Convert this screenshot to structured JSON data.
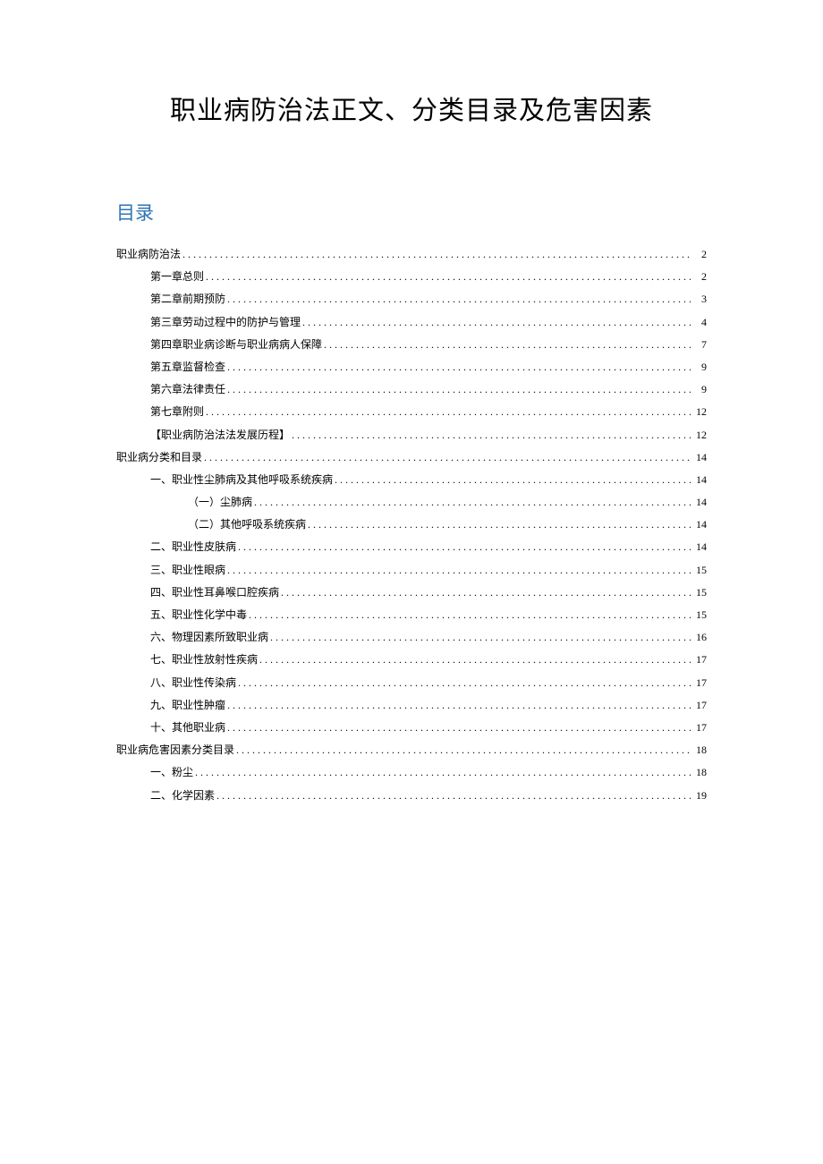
{
  "title": "职业病防治法正文、分类目录及危害因素",
  "toc_heading": "目录",
  "toc": [
    {
      "level": 0,
      "text": "职业病防治法",
      "page": "2"
    },
    {
      "level": 1,
      "text": "第一章总则",
      "page": "2"
    },
    {
      "level": 1,
      "text": "第二章前期预防",
      "page": "3"
    },
    {
      "level": 1,
      "text": "第三章劳动过程中的防护与管理",
      "page": "4"
    },
    {
      "level": 1,
      "text": "第四章职业病诊断与职业病病人保障",
      "page": "7"
    },
    {
      "level": 1,
      "text": "第五章监督检查",
      "page": "9"
    },
    {
      "level": 1,
      "text": "第六章法律责任",
      "page": "9"
    },
    {
      "level": 1,
      "text": "第七章附则",
      "page": "12"
    },
    {
      "level": 1,
      "text": "【职业病防治法法发展历程】",
      "page": "12"
    },
    {
      "level": 0,
      "text": "职业病分类和目录",
      "page": "14"
    },
    {
      "level": 1,
      "text": "一、职业性尘肺病及其他呼吸系统疾病",
      "page": "14"
    },
    {
      "level": 2,
      "text": "（一）尘肺病",
      "page": "14"
    },
    {
      "level": 2,
      "text": "（二）其他呼吸系统疾病",
      "page": "14"
    },
    {
      "level": 1,
      "text": "二、职业性皮肤病",
      "page": "14"
    },
    {
      "level": 1,
      "text": "三、职业性眼病",
      "page": "15"
    },
    {
      "level": 1,
      "text": "四、职业性耳鼻喉口腔疾病",
      "page": "15"
    },
    {
      "level": 1,
      "text": "五、职业性化学中毒",
      "page": "15"
    },
    {
      "level": 1,
      "text": "六、物理因素所致职业病",
      "page": "16"
    },
    {
      "level": 1,
      "text": "七、职业性放射性疾病",
      "page": "17"
    },
    {
      "level": 1,
      "text": "八、职业性传染病",
      "page": "17"
    },
    {
      "level": 1,
      "text": "九、职业性肿瘤",
      "page": "17"
    },
    {
      "level": 1,
      "text": "十、其他职业病",
      "page": "17"
    },
    {
      "level": 0,
      "text": "职业病危害因素分类目录",
      "page": "18"
    },
    {
      "level": 1,
      "text": "一、粉尘",
      "page": "18"
    },
    {
      "level": 1,
      "text": "二、化学因素",
      "page": "19"
    }
  ]
}
